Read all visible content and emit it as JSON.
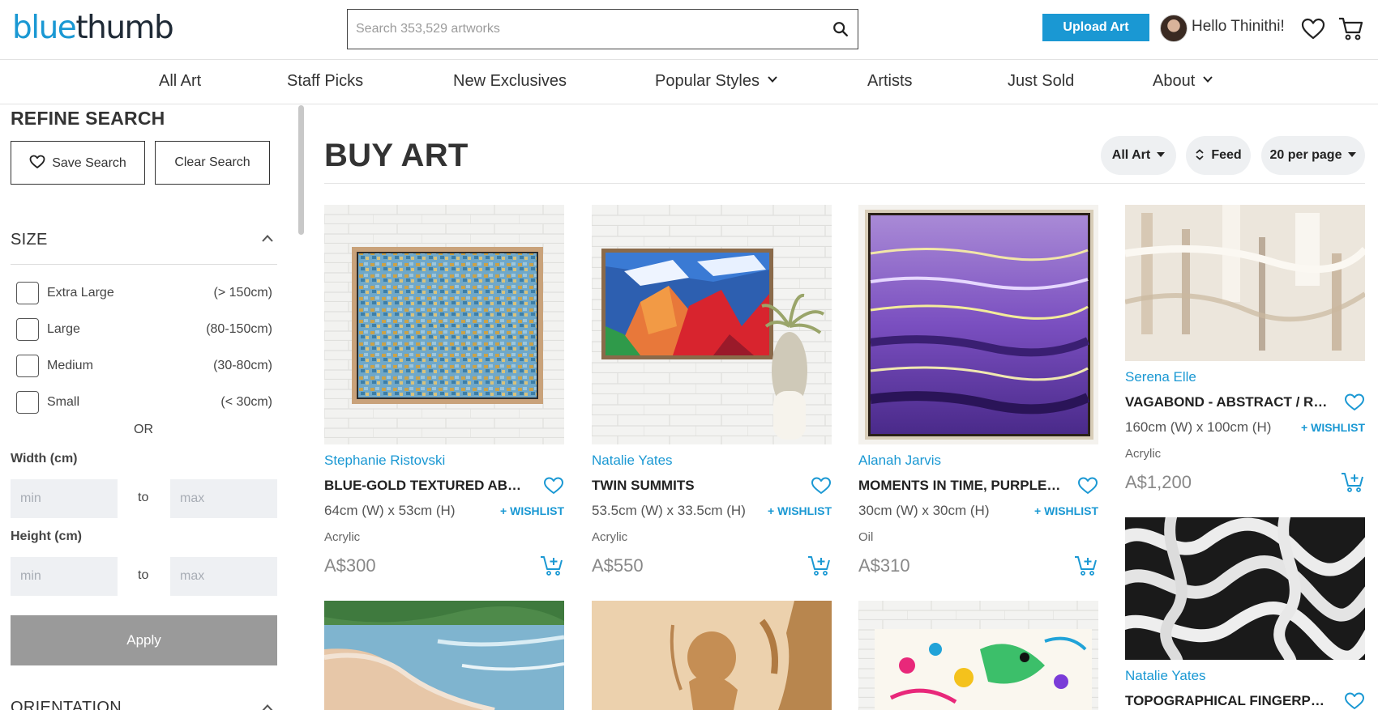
{
  "brand": {
    "part1": "blue",
    "part2": "thumb",
    "accent_color": "#1a98d3"
  },
  "search": {
    "placeholder": "Search 353,529 artworks",
    "value": ""
  },
  "header": {
    "upload_label": "Upload Art",
    "greeting": "Hello Thinithi!"
  },
  "nav": {
    "items": [
      {
        "label": "All Art",
        "dropdown": false
      },
      {
        "label": "Staff Picks",
        "dropdown": false
      },
      {
        "label": "New Exclusives",
        "dropdown": false
      },
      {
        "label": "Popular Styles",
        "dropdown": true
      },
      {
        "label": "Artists",
        "dropdown": false
      },
      {
        "label": "Just Sold",
        "dropdown": false
      },
      {
        "label": "About",
        "dropdown": true
      }
    ]
  },
  "sidebar": {
    "title": "REFINE SEARCH",
    "save_label": "Save Search",
    "clear_label": "Clear Search",
    "size": {
      "title": "SIZE",
      "options": [
        {
          "label": "Extra Large",
          "range": "(> 150cm)",
          "checked": false
        },
        {
          "label": "Large",
          "range": "(80-150cm)",
          "checked": false
        },
        {
          "label": "Medium",
          "range": "(30-80cm)",
          "checked": false
        },
        {
          "label": "Small",
          "range": "(< 30cm)",
          "checked": false
        }
      ],
      "or_text": "OR",
      "width_label": "Width (cm)",
      "height_label": "Height (cm)",
      "min_placeholder": "min",
      "max_placeholder": "max",
      "to_text": "to",
      "apply_label": "Apply"
    },
    "orientation": {
      "title": "ORIENTATION"
    }
  },
  "main": {
    "title": "BUY ART",
    "filters": {
      "category": "All Art",
      "view": "Feed",
      "per_page": "20 per page"
    },
    "wishlist_label": "+ WISHLIST",
    "products": [
      {
        "artist": "Stephanie Ristovski",
        "title": "BLUE-GOLD TEXTURED ABSTRACT",
        "dims": "64cm (W) x 53cm (H)",
        "medium": "Acrylic",
        "price": "A$300"
      },
      {
        "artist": "Natalie Yates",
        "title": "TWIN SUMMITS",
        "dims": "53.5cm (W) x 33.5cm (H)",
        "medium": "Acrylic",
        "price": "A$550"
      },
      {
        "artist": "Alanah Jarvis",
        "title": "MOMENTS IN TIME, PURPLE OCEAN",
        "dims": "30cm (W) x 30cm (H)",
        "medium": "Oil",
        "price": "A$310"
      },
      {
        "artist": "Serena Elle",
        "title": "VAGABOND - ABSTRACT / REFLECTION",
        "dims": "160cm (W) x 100cm (H)",
        "medium": "Acrylic",
        "price": "A$1,200"
      },
      {
        "artist": "Natalie Yates",
        "title": "TOPOGRAPHICAL FINGERPRINT"
      }
    ]
  }
}
